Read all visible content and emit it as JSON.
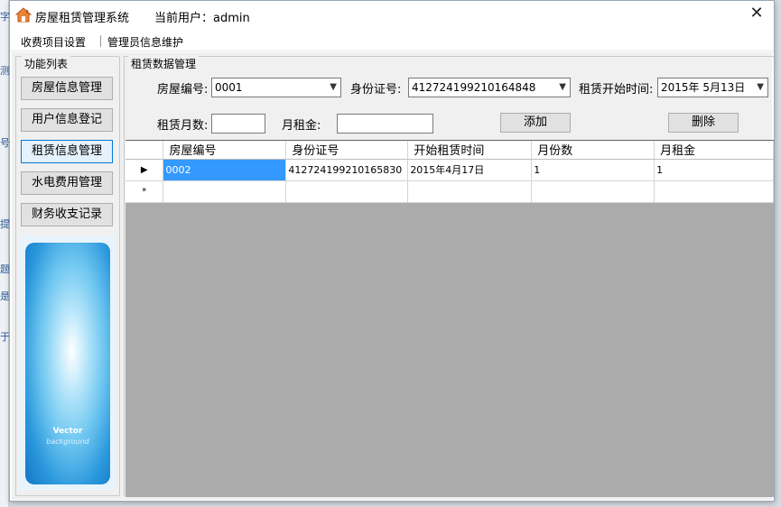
{
  "app": {
    "title": "房屋租赁管理系统",
    "current_user": "当前用户：admin",
    "close_symbol": "✕"
  },
  "menu": {
    "items": [
      "收费项目设置",
      "管理员信息维护"
    ]
  },
  "function_list": {
    "legend": "功能列表",
    "buttons": [
      "房屋信息管理",
      "用户信息登记",
      "租赁信息管理",
      "水电费用管理",
      "财务收支记录"
    ],
    "active_index": 2,
    "promo": {
      "title": "Vector",
      "subtitle": "background"
    }
  },
  "rental": {
    "legend": "租赁数据管理",
    "house_no_label": "房屋编号:",
    "house_no_value": "0001",
    "id_label": "身份证号:",
    "id_value": "412724199210164848",
    "start_label": "租赁开始时间:",
    "start_value": "2015年  5月13日",
    "months_label": "租赁月数:",
    "months_value": "",
    "rent_label": "月租金:",
    "rent_value": "",
    "add_button": "添加",
    "delete_button": "删除"
  },
  "grid": {
    "columns": [
      "房屋编号",
      "身份证号",
      "开始租赁时间",
      "月份数",
      "月租金"
    ],
    "rows": [
      {
        "indicator": "▶",
        "cells": [
          "0002",
          "412724199210165830",
          "2015年4月17日",
          "1",
          "1"
        ]
      },
      {
        "indicator": "*",
        "cells": [
          "",
          "",
          "",
          "",
          ""
        ]
      }
    ]
  },
  "icons": {
    "app": "house-icon",
    "close": "close-icon",
    "dropdown": "chevron-down-icon"
  }
}
